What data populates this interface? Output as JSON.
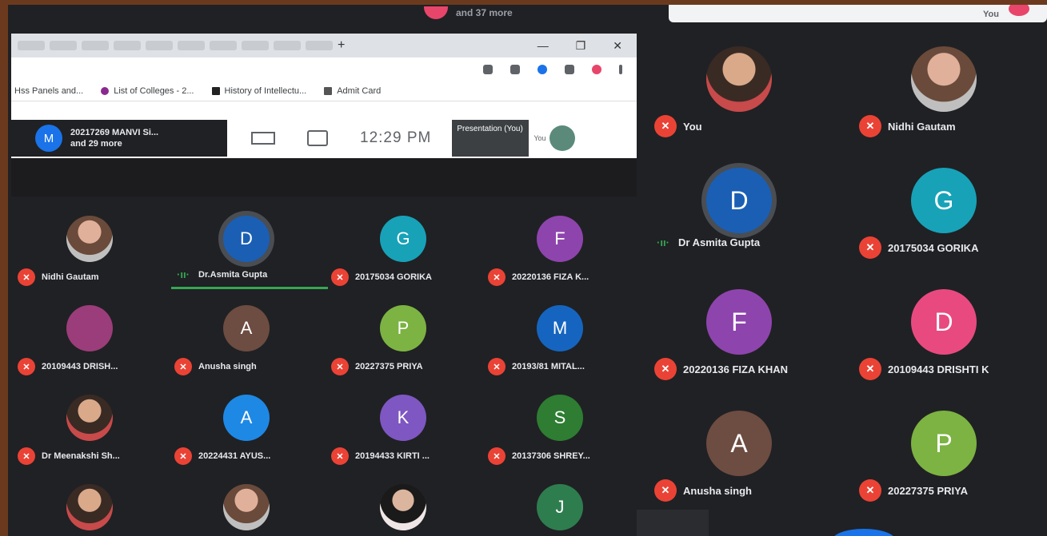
{
  "top": {
    "pill_text": "and 37 more",
    "you_label": "You"
  },
  "browser": {
    "bookmarks": [
      "Hss Panels and...",
      "List of Colleges - 2...",
      "History of Intellectu...",
      "Admit Card"
    ],
    "window_controls": [
      "—",
      "❐",
      "✕"
    ]
  },
  "meetbar": {
    "avatar_letter": "M",
    "presenter_line1": "20217269 MANVI Si...",
    "presenter_line2": "and 29 more",
    "time": "12:29 PM",
    "presentation_label": "Presentation (You)",
    "you_label": "You"
  },
  "left_tiles": [
    {
      "name": "Nidhi Gautam",
      "letter": "",
      "color": "",
      "photo": "photo2",
      "mic": "off"
    },
    {
      "name": "Dr.Asmita Gupta",
      "letter": "D",
      "color": "#1a5fb4",
      "mic": "speaking"
    },
    {
      "name": "20175034 GORIKA",
      "letter": "G",
      "color": "#17a2b8",
      "mic": "off"
    },
    {
      "name": "20220136 FIZA K...",
      "letter": "F",
      "color": "#8e44ad",
      "mic": "off"
    },
    {
      "name": "20109443 DRISH...",
      "letter": "",
      "color": "#9b3d7a",
      "mic": "off"
    },
    {
      "name": "Anusha singh",
      "letter": "A",
      "color": "#6d4c41",
      "mic": "off"
    },
    {
      "name": "20227375 PRIYA",
      "letter": "P",
      "color": "#7cb342",
      "mic": "off"
    },
    {
      "name": "20193/81 MITAL...",
      "letter": "M",
      "color": "#1565c0",
      "mic": "off"
    },
    {
      "name": "Dr Meenakshi Sh...",
      "letter": "",
      "color": "",
      "photo": "photo",
      "mic": "off"
    },
    {
      "name": "20224431 AYUS...",
      "letter": "A",
      "color": "#1e88e5",
      "mic": "off"
    },
    {
      "name": "20194433 KIRTI ...",
      "letter": "K",
      "color": "#7e57c2",
      "mic": "off"
    },
    {
      "name": "20137306 SHREY...",
      "letter": "S",
      "color": "#2e7d32",
      "mic": "off"
    },
    {
      "name": "",
      "letter": "",
      "color": "",
      "photo": "photo",
      "mic": "off"
    },
    {
      "name": "",
      "letter": "",
      "color": "",
      "photo": "photo2",
      "mic": "off"
    },
    {
      "name": "",
      "letter": "",
      "color": "",
      "photo": "photo3",
      "mic": "off"
    },
    {
      "name": "",
      "letter": "J",
      "color": "#2e7d4f",
      "mic": "off"
    }
  ],
  "right_tiles": [
    {
      "name": "You",
      "letter": "",
      "color": "",
      "photo": "photo",
      "mic": "off"
    },
    {
      "name": "Nidhi Gautam",
      "letter": "",
      "color": "",
      "photo": "photo2",
      "mic": "off"
    },
    {
      "name": "Dr Asmita Gupta",
      "letter": "D",
      "color": "#1a5fb4",
      "mic": "speaking"
    },
    {
      "name": "20175034 GORIKA",
      "letter": "G",
      "color": "#17a2b8",
      "mic": "off"
    },
    {
      "name": "20220136 FIZA KHAN",
      "letter": "F",
      "color": "#8e44ad",
      "mic": "off"
    },
    {
      "name": "20109443 DRISHTI K",
      "letter": "D",
      "color": "#e84a7f",
      "mic": "off"
    },
    {
      "name": "Anusha singh",
      "letter": "A",
      "color": "#6d4c41",
      "mic": "off"
    },
    {
      "name": "20227375 PRIYA",
      "letter": "P",
      "color": "#7cb342",
      "mic": "off"
    }
  ]
}
